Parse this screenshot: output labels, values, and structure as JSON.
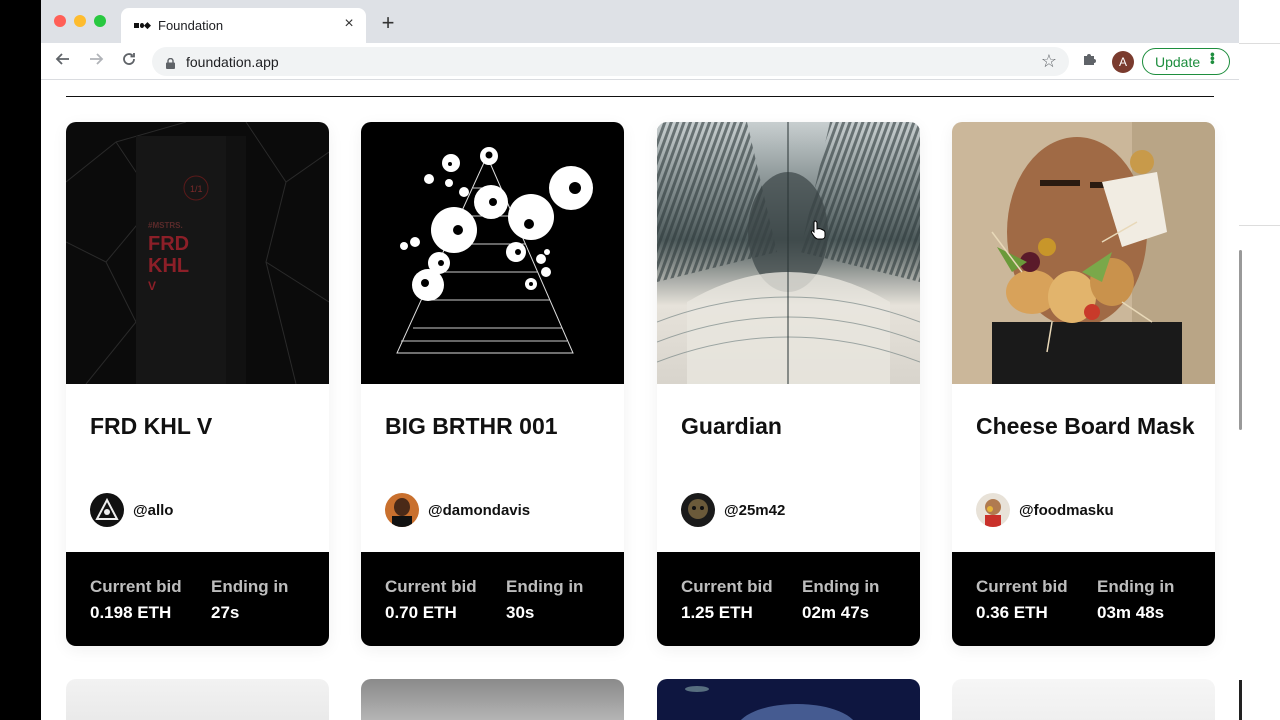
{
  "browser": {
    "tab_title": "Foundation",
    "new_tab_symbol": "+",
    "close_symbol": "×",
    "url": "foundation.app",
    "profile_initial": "A",
    "update_label": "Update"
  },
  "cards": [
    {
      "title": "FRD KHL V",
      "handle": "@allo",
      "bid_label": "Current bid",
      "bid_value": "0.198 ETH",
      "ending_label": "Ending in",
      "ending_value": "27s",
      "art_text": [
        "1/1",
        "#MSTRS.",
        "FRD",
        "KHL",
        "V"
      ]
    },
    {
      "title": "BIG BRTHR 001",
      "handle": "@damondavis",
      "bid_label": "Current bid",
      "bid_value": "0.70 ETH",
      "ending_label": "Ending in",
      "ending_value": "30s"
    },
    {
      "title": "Guardian",
      "handle": "@25m42",
      "bid_label": "Current bid",
      "bid_value": "1.25 ETH",
      "ending_label": "Ending in",
      "ending_value": "02m 47s"
    },
    {
      "title": "Cheese Board Mask",
      "handle": "@foodmasku",
      "bid_label": "Current bid",
      "bid_value": "0.36 ETH",
      "ending_label": "Ending in",
      "ending_value": "03m 48s"
    }
  ],
  "colors": {
    "page_bg": "#ffffff",
    "card_footer": "#000000",
    "update_green": "#1e8e3e"
  }
}
